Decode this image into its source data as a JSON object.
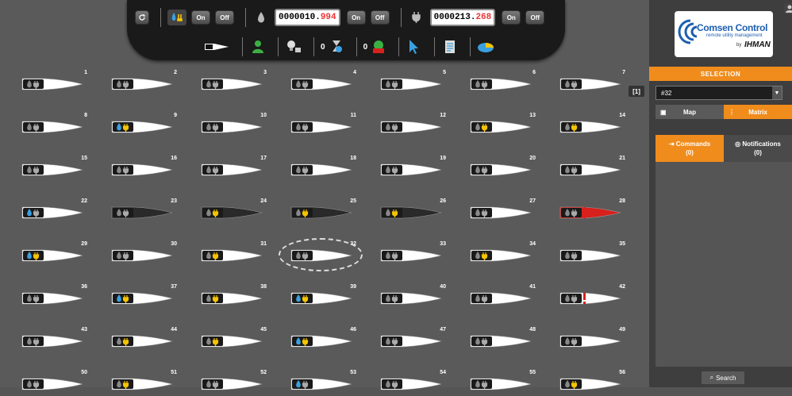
{
  "toolbar": {
    "on_label": "On",
    "off_label": "Off",
    "water_counter_int": "0000010.",
    "water_counter_dec": "994",
    "power_counter_int": "0000213.",
    "power_counter_dec": "268",
    "row2_count_a": "0",
    "row2_count_b": "0"
  },
  "page_indicator": "[1]",
  "devices": [
    {
      "n": "1",
      "type": "ww"
    },
    {
      "n": "2",
      "type": "ww"
    },
    {
      "n": "3",
      "type": "ww"
    },
    {
      "n": "4",
      "type": "ww"
    },
    {
      "n": "5",
      "type": "ww"
    },
    {
      "n": "6",
      "type": "ww"
    },
    {
      "n": "7",
      "type": "ww"
    },
    {
      "n": "8",
      "type": "ww"
    },
    {
      "n": "9",
      "type": "by"
    },
    {
      "n": "10",
      "type": "ww"
    },
    {
      "n": "11",
      "type": "ww"
    },
    {
      "n": "12",
      "type": "ww"
    },
    {
      "n": "13",
      "type": "wy"
    },
    {
      "n": "14",
      "type": "wy"
    },
    {
      "n": "15",
      "type": "ww"
    },
    {
      "n": "16",
      "type": "ww"
    },
    {
      "n": "17",
      "type": "ww"
    },
    {
      "n": "18",
      "type": "ww"
    },
    {
      "n": "19",
      "type": "ww"
    },
    {
      "n": "20",
      "type": "ww"
    },
    {
      "n": "21",
      "type": "ww"
    },
    {
      "n": "22",
      "type": "bw"
    },
    {
      "n": "23",
      "type": "dark-ww"
    },
    {
      "n": "24",
      "type": "dark-wy"
    },
    {
      "n": "25",
      "type": "dark-wy"
    },
    {
      "n": "26",
      "type": "dark-wy"
    },
    {
      "n": "27",
      "type": "ww"
    },
    {
      "n": "28",
      "type": "alarm-red"
    },
    {
      "n": "29",
      "type": "by"
    },
    {
      "n": "30",
      "type": "ww"
    },
    {
      "n": "31",
      "type": "wy"
    },
    {
      "n": "32",
      "type": "selected"
    },
    {
      "n": "33",
      "type": "ww"
    },
    {
      "n": "34",
      "type": "wy"
    },
    {
      "n": "35",
      "type": "ww"
    },
    {
      "n": "36",
      "type": "ww"
    },
    {
      "n": "37",
      "type": "by"
    },
    {
      "n": "38",
      "type": "wy"
    },
    {
      "n": "39",
      "type": "by"
    },
    {
      "n": "40",
      "type": "ww"
    },
    {
      "n": "41",
      "type": "ww"
    },
    {
      "n": "42",
      "type": "alarm"
    },
    {
      "n": "43",
      "type": "ww"
    },
    {
      "n": "44",
      "type": "wy"
    },
    {
      "n": "45",
      "type": "wy"
    },
    {
      "n": "46",
      "type": "by"
    },
    {
      "n": "47",
      "type": "ww"
    },
    {
      "n": "48",
      "type": "ww"
    },
    {
      "n": "49",
      "type": "ww"
    },
    {
      "n": "50",
      "type": "ww"
    },
    {
      "n": "51",
      "type": "wy"
    },
    {
      "n": "52",
      "type": "ww"
    },
    {
      "n": "53",
      "type": "bw"
    },
    {
      "n": "54",
      "type": "ww"
    },
    {
      "n": "55",
      "type": "ww"
    },
    {
      "n": "56",
      "type": "wy"
    }
  ],
  "sidebar": {
    "logo_title": "Comsen Control",
    "logo_subtitle": "remote utility management",
    "logo_by": "by",
    "logo_brand": "IHMAN",
    "selection_header": "SELECTION",
    "selected_value": "#32",
    "tab_map": "Map",
    "tab_matrix": "Matrix",
    "tab_commands": "Commands",
    "tab_commands_count": "(0)",
    "tab_notifications": "Notifications",
    "tab_notifications_count": "(0)",
    "search_label": "Search"
  },
  "colors": {
    "accent": "#f08c1c",
    "water_blue": "#3aa0e0",
    "power_yellow": "#f5c400",
    "alarm_red": "#d8201c",
    "counter_decimal": "#e33333"
  }
}
